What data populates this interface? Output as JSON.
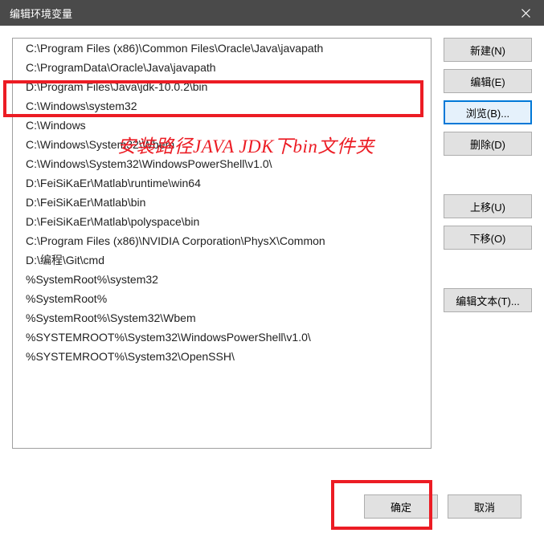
{
  "titlebar": {
    "title": "编辑环境变量"
  },
  "list": {
    "items": [
      "C:\\Program Files (x86)\\Common Files\\Oracle\\Java\\javapath",
      "C:\\ProgramData\\Oracle\\Java\\javapath",
      "D:\\Program Files\\Java\\jdk-10.0.2\\bin",
      "C:\\Windows\\system32",
      "C:\\Windows",
      "C:\\Windows\\System32\\Wbem",
      "C:\\Windows\\System32\\WindowsPowerShell\\v1.0\\",
      "D:\\FeiSiKaEr\\Matlab\\runtime\\win64",
      "D:\\FeiSiKaEr\\Matlab\\bin",
      "D:\\FeiSiKaEr\\Matlab\\polyspace\\bin",
      "C:\\Program Files (x86)\\NVIDIA Corporation\\PhysX\\Common",
      "D:\\编程\\Git\\cmd",
      "%SystemRoot%\\system32",
      "%SystemRoot%",
      "%SystemRoot%\\System32\\Wbem",
      "%SYSTEMROOT%\\System32\\WindowsPowerShell\\v1.0\\",
      "%SYSTEMROOT%\\System32\\OpenSSH\\"
    ]
  },
  "buttons": {
    "new": "新建(N)",
    "edit": "编辑(E)",
    "browse": "浏览(B)...",
    "delete": "删除(D)",
    "moveUp": "上移(U)",
    "moveDown": "下移(O)",
    "editText": "编辑文本(T)...",
    "ok": "确定",
    "cancel": "取消"
  },
  "annotation": {
    "text": "安装路径JAVA JDK下bin文件夹"
  }
}
